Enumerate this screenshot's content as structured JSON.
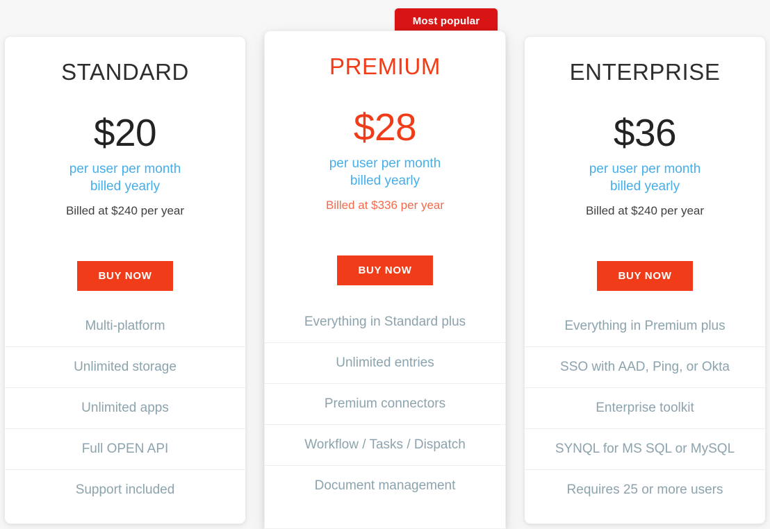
{
  "badge": {
    "label": "Most popular",
    "color": "#d91414"
  },
  "accent": {
    "primary": "#f03c18",
    "cadence_blue": "#47aee8",
    "feature_gray": "#8ca3ad"
  },
  "plans": [
    {
      "id": "standard",
      "title": "STANDARD",
      "price": "$20",
      "cadence_line1": "per user per month",
      "cadence_line2": "billed yearly",
      "billing_note": "Billed at $240 per year",
      "cta_label": "BUY NOW",
      "features": [
        "Multi-platform",
        "Unlimited storage",
        "Unlimited apps",
        "Full OPEN API",
        "Support included"
      ]
    },
    {
      "id": "premium",
      "title": "PREMIUM",
      "price": "$28",
      "cadence_line1": "per user per month",
      "cadence_line2": "billed yearly",
      "billing_note": "Billed at $336 per year",
      "cta_label": "BUY NOW",
      "features": [
        "Everything in Standard plus",
        "Unlimited entries",
        "Premium connectors",
        "Workflow / Tasks / Dispatch",
        "Document management"
      ]
    },
    {
      "id": "enterprise",
      "title": "ENTERPRISE",
      "price": "$36",
      "cadence_line1": "per user per month",
      "cadence_line2": "billed yearly",
      "billing_note": "Billed at $240 per year",
      "cta_label": "BUY NOW",
      "features": [
        "Everything in Premium plus",
        "SSO with AAD, Ping, or Okta",
        "Enterprise toolkit",
        "SYNQL for MS SQL or MySQL",
        "Requires 25 or more users"
      ]
    }
  ]
}
